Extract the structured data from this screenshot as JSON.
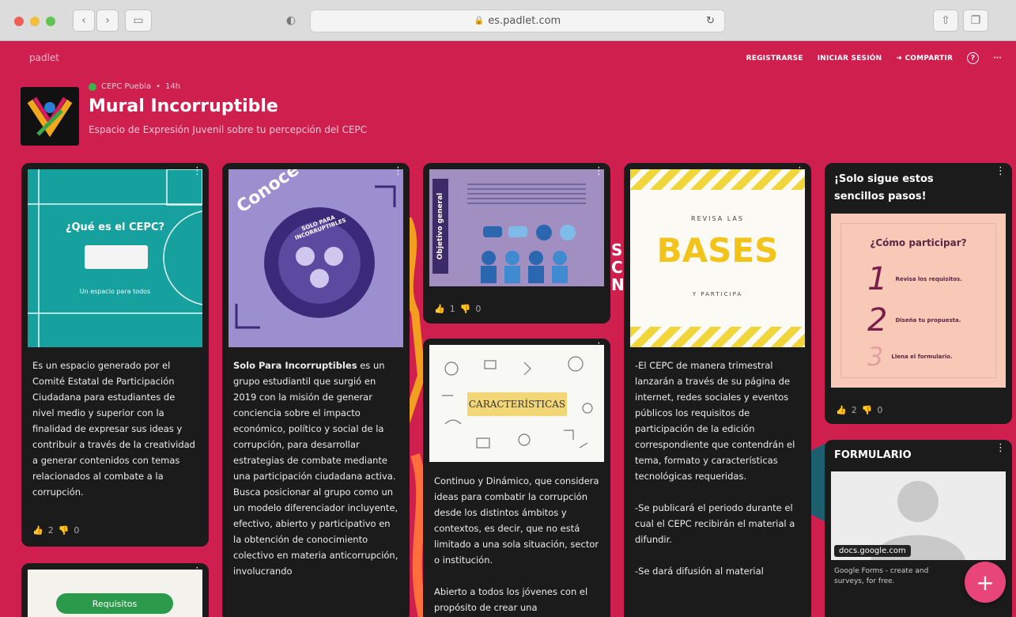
{
  "browser": {
    "url": "es.padlet.com"
  },
  "header": {
    "brand": "padlet",
    "register": "REGISTRARSE",
    "login": "INICIAR SESIÓN",
    "share": "COMPARTIR",
    "help": "?",
    "more": "···"
  },
  "board": {
    "author": "CEPC Puebla",
    "time": "14h",
    "title": "Mural Incorruptible",
    "subtitle": "Espacio de Expresión Juvenil sobre tu percepción del CEPC"
  },
  "posts": {
    "cepc": {
      "img_title": "¿Qué es el CEPC?",
      "img_caption": "Un espacio para todos",
      "body": "Es un espacio generado por el Comité Estatal de Participación Ciudadana para estudiantes de nivel medio y superior con la finalidad de expresar sus ideas y contribuir a través de la creatividad a generar contenidos con temas relacionados al combate a la corrupción.",
      "likes": "2",
      "dislikes": "0"
    },
    "conoce": {
      "img_title": "Conoce a",
      "img_badge": "SOLO PARA INCORRUPTIBLES",
      "body_bold": "Solo Para Incorruptibles",
      "body": " es un grupo estudiantil que surgió en 2019 con la misión de generar conciencia sobre el impacto económico, político y social de la corrupción, para desarrollar estrategias de combate mediante una participación ciudadana activa. Busca posicionar al grupo como un un modelo diferenciador incluyente, efectivo, abierto y participativo en la obtención de conocimiento colectivo en materia anticorrupción, involucrando"
    },
    "objetivo": {
      "img_label": "Objetivo general",
      "likes": "1",
      "dislikes": "0"
    },
    "caracteristicas": {
      "img_title": "CARACTERÍSTICAS",
      "body1": "Continuo y Dinámico, que considera ideas para combatir la corrupción desde los distintos ámbitos y contextos, es decir, que no está limitado a una sola situación, sector o institución.",
      "body2": "Abierto a todos los jóvenes con el propósito de crear una"
    },
    "bases": {
      "img_top": "REVISA LAS",
      "img_main": "BASES",
      "img_bottom": "Y PARTICIPA",
      "p1": "-El CEPC de manera trimestral lanzarán a través de su página de internet, redes sociales y eventos públicos los requisitos de participación de la edición correspondiente que contendrán el tema, formato y características tecnológicas requeridas.",
      "p2": "-Se publicará el periodo durante el cual el CEPC recibirán el material a difundir.",
      "p3": "-Se dará difusión al material"
    },
    "pasos": {
      "title": "¡Solo sigue estos sencillos pasos!",
      "img_title": "¿Cómo participar?",
      "steps": [
        "Revisa los requisitos.",
        "Diseña tu propuesta.",
        "Llena el formulario."
      ],
      "likes": "2",
      "dislikes": "0"
    },
    "formulario": {
      "title": "FORMULARIO",
      "domain": "docs.google.com",
      "desc": "Google Forms - create and surveys, for free."
    },
    "requisitos": {
      "button": "Requisitos"
    }
  },
  "fab_label": "+"
}
